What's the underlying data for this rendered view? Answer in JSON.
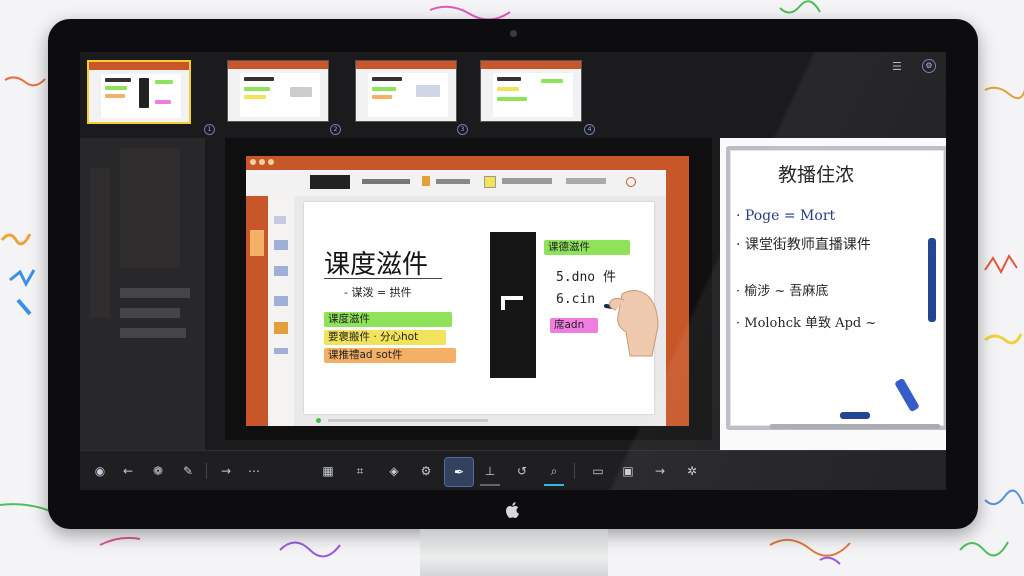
{
  "thumbnails": [
    {
      "number": "1",
      "active": true
    },
    {
      "number": "2",
      "active": false
    },
    {
      "number": "3",
      "active": false
    },
    {
      "number": "4",
      "active": false
    }
  ],
  "top_icons": {
    "menu": "list-icon",
    "settings": "gear-icon"
  },
  "slide": {
    "title": "课度滋件",
    "subtitle": "- 谋泼 = 拱件",
    "left_items": [
      "课度滋件",
      "要褒搬件 · 分心hot",
      "课推禮ad sot件"
    ],
    "right_items": [
      "课德滋件",
      "5.dno 件",
      "6.cin",
      "席adn"
    ]
  },
  "whiteboard": {
    "title": "教播住浓",
    "lines": [
      "· Poge = Mort",
      "· 课堂街教师直播课件",
      "· 榆涉 ~ 吾麻底",
      "· Molohck 单致 Apd ~"
    ]
  },
  "colors": {
    "accent_orange": "#c75628",
    "highlight_green": "#8fe35a",
    "highlight_yellow": "#f1e35a",
    "highlight_orange": "#f4b066",
    "highlight_pink": "#f07ee0",
    "thumb_active_border": "#f2d12a",
    "toolbar_active": "#33415e"
  },
  "toolbar": {
    "buttons": [
      {
        "name": "record-button",
        "icon": "circle-icon",
        "glyph": "◉"
      },
      {
        "name": "back-button",
        "icon": "arrow-left-icon",
        "glyph": "←"
      },
      {
        "name": "palette-button",
        "icon": "palette-icon",
        "glyph": "❁"
      },
      {
        "name": "edit-button",
        "icon": "edit-icon",
        "glyph": "✎"
      },
      {
        "name": "forward-button",
        "icon": "arrow-right-icon",
        "glyph": "→"
      },
      {
        "name": "more-button",
        "icon": "wave-icon",
        "glyph": "⋯"
      },
      {
        "name": "grid-button",
        "icon": "grid-icon",
        "glyph": "▦"
      },
      {
        "name": "crop-button",
        "icon": "crop-icon",
        "glyph": "⌗"
      },
      {
        "name": "layers-button",
        "icon": "layers-icon",
        "glyph": "◈"
      },
      {
        "name": "settings-button",
        "icon": "gear-icon",
        "glyph": "⚙"
      },
      {
        "name": "pen-button",
        "icon": "pen-icon",
        "glyph": "✒"
      },
      {
        "name": "stamp-button",
        "icon": "stamp-icon",
        "glyph": "⊥"
      },
      {
        "name": "undo-button",
        "icon": "undo-icon",
        "glyph": "↺"
      },
      {
        "name": "zoom-button",
        "icon": "magnifier-icon",
        "glyph": "⌕"
      },
      {
        "name": "screen-button",
        "icon": "screen-icon",
        "glyph": "▭"
      },
      {
        "name": "image-button",
        "icon": "image-icon",
        "glyph": "▣"
      },
      {
        "name": "next-button",
        "icon": "arrow-right-icon",
        "glyph": "→"
      },
      {
        "name": "share-button",
        "icon": "share-icon",
        "glyph": "✲"
      }
    ]
  }
}
